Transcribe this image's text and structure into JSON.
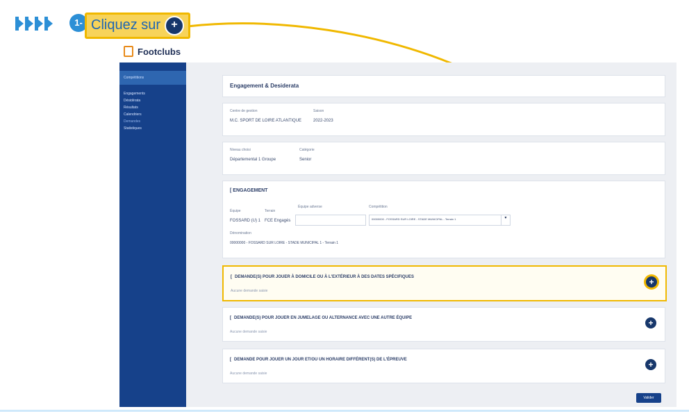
{
  "banner": {
    "step": "1-",
    "text": "Cliquez sur",
    "plus": "+"
  },
  "app": {
    "logo": "Footclubs"
  },
  "sidebar": {
    "header": "Compétitions",
    "items": [
      "Engagements",
      "Désidérata",
      "Résultats",
      "Calendriers",
      "Demandes",
      "Statistiques"
    ]
  },
  "main": {
    "header_title": "Engagement & Desiderata",
    "card_info": {
      "label1": "Centre de gestion",
      "value1": "M.C. SPORT DE LOIRE ATLANTIQUE",
      "label2": "Saison",
      "value2": "2022-2023"
    },
    "card_level": {
      "label1": "Niveau choisi",
      "value1": "Départemental 1 Groupe",
      "label2": "Catégorie",
      "value2": "Senior"
    },
    "engagement": {
      "title": "ENGAGEMENT",
      "field1_label": "Équipe",
      "field1_value": "FOSSARD (U) 1",
      "field2_label": "Terrain",
      "field2_value": "FCE Engagés",
      "field3_label": "Équipe adverse",
      "field4_label": "Compétition",
      "select_value": "00000000 - FOSSARD SUR LOIRE - STADE MUNICIPAL - Terrain 1",
      "bottom_label": "Dénomination",
      "bottom_value": "00000000 - FOSSARD SUR LOIRE - STADE MUNICIPAL 1 - Terrain 1"
    },
    "sections": [
      {
        "title": "DEMANDE(S) POUR JOUER À DOMICILE OU À L'EXTÉRIEUR À DES DATES SPÉCIFIQUES",
        "sub": "Aucune demande saisie"
      },
      {
        "title": "DEMANDE(S) POUR JOUER EN JUMELAGE OU ALTERNANCE AVEC UNE AUTRE ÉQUIPE",
        "sub": "Aucune demande saisie"
      },
      {
        "title": "DEMANDE POUR JOUER UN JOUR ET/OU UN HORAIRE DIFFÉRENT(S) DE L'ÉPREUVE",
        "sub": "Aucune demande saisie"
      }
    ],
    "validate": "Valider",
    "plus_glyph": "+"
  },
  "colors": {
    "sidebar": "#16418a",
    "highlight": "#f0b800",
    "accent": "#2c8fd6",
    "button": "#17376b"
  }
}
